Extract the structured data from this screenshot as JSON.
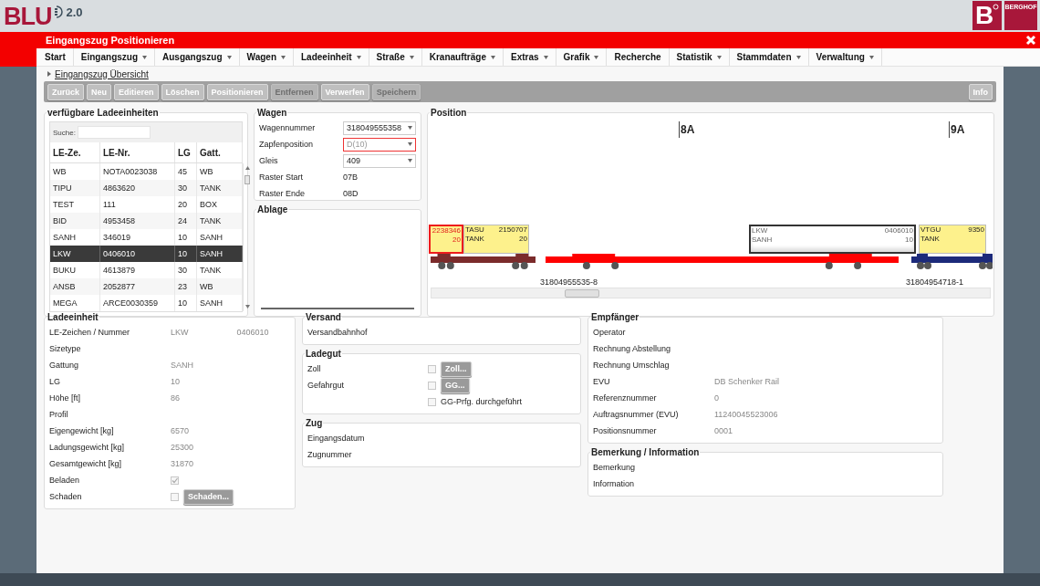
{
  "header": {
    "logo_text": "BLU",
    "version": "2.0",
    "brand_mark": "B",
    "brand_name": "BERGHOF"
  },
  "window": {
    "title": "Eingangszug Positionieren"
  },
  "menu": [
    {
      "label": "Start",
      "dropdown": false
    },
    {
      "label": "Eingangszug",
      "dropdown": true
    },
    {
      "label": "Ausgangszug",
      "dropdown": true
    },
    {
      "label": "Wagen",
      "dropdown": true
    },
    {
      "label": "Ladeeinheit",
      "dropdown": true
    },
    {
      "label": "Straße",
      "dropdown": true
    },
    {
      "label": "Kranaufträge",
      "dropdown": true
    },
    {
      "label": "Extras",
      "dropdown": true
    },
    {
      "label": "Grafik",
      "dropdown": true
    },
    {
      "label": "Recherche",
      "dropdown": false
    },
    {
      "label": "Statistik",
      "dropdown": true
    },
    {
      "label": "Stammdaten",
      "dropdown": true
    },
    {
      "label": "Verwaltung",
      "dropdown": true
    }
  ],
  "breadcrumb": "Eingangszug Übersicht",
  "toolbar": {
    "buttons": [
      {
        "label": "Zurück",
        "disabled": false
      },
      {
        "label": "Neu",
        "disabled": false
      },
      {
        "label": "Editieren",
        "disabled": false
      },
      {
        "label": "Löschen",
        "disabled": false
      },
      {
        "label": "Positionieren",
        "disabled": false
      },
      {
        "label": "Entfernen",
        "disabled": true
      },
      {
        "label": "Verwerfen",
        "disabled": false
      },
      {
        "label": "Speichern",
        "disabled": true
      }
    ],
    "info": {
      "label": "Info",
      "disabled": false
    }
  },
  "units_panel": {
    "title": "verfügbare Ladeeinheiten",
    "search_label": "Suche:",
    "columns": [
      "LE-Ze.",
      "LE-Nr.",
      "LG",
      "Gatt."
    ],
    "rows": [
      {
        "cells": [
          "WB",
          "NOTA0023038",
          "45",
          "WB"
        ],
        "selected": false
      },
      {
        "cells": [
          "TIPU",
          "4863620",
          "30",
          "TANK"
        ],
        "selected": false
      },
      {
        "cells": [
          "TEST",
          "111",
          "20",
          "BOX"
        ],
        "selected": false
      },
      {
        "cells": [
          "BID",
          "4953458",
          "24",
          "TANK"
        ],
        "selected": false
      },
      {
        "cells": [
          "SANH",
          "346019",
          "10",
          "SANH"
        ],
        "selected": false
      },
      {
        "cells": [
          "LKW",
          "0406010",
          "10",
          "SANH"
        ],
        "selected": true
      },
      {
        "cells": [
          "BUKU",
          "4613879",
          "30",
          "TANK"
        ],
        "selected": false
      },
      {
        "cells": [
          "ANSB",
          "2052877",
          "23",
          "WB"
        ],
        "selected": false
      },
      {
        "cells": [
          "MEGA",
          "ARCE0030359",
          "10",
          "SANH"
        ],
        "selected": false
      }
    ]
  },
  "wagon_panel": {
    "title": "Wagen",
    "fields": [
      {
        "label": "Wagennummer",
        "kind": "select",
        "value": "318049555358",
        "invalid": false
      },
      {
        "label": "Zapfenposition",
        "kind": "select",
        "value": "D(10)",
        "invalid": true
      },
      {
        "label": "Gleis",
        "kind": "select",
        "value": "409",
        "invalid": false
      },
      {
        "label": "Raster Start",
        "kind": "text",
        "value": "07B"
      },
      {
        "label": "Raster Ende",
        "kind": "text",
        "value": "08D"
      }
    ]
  },
  "storage_panel": {
    "title": "Ablage"
  },
  "position_panel": {
    "title": "Position",
    "grid_marks": [
      "8A",
      "9A"
    ],
    "units": [
      {
        "kind": "alert",
        "number": "2238346",
        "length": "20"
      },
      {
        "kind": "plain",
        "code": "TASU",
        "number": "2150707",
        "type": "TANK",
        "length": "20"
      },
      {
        "kind": "selected",
        "code": "LKW",
        "number": "0406010",
        "type": "SANH",
        "length": "10"
      },
      {
        "kind": "plain",
        "code": "VTGU",
        "number": "9350",
        "type": "TANK"
      }
    ],
    "wagons": [
      {
        "color": "#7b2b2b"
      },
      {
        "color": "#ff0000",
        "number": "31804955535-8"
      },
      {
        "color": "#1c2a7a",
        "number": "31804954718-1"
      }
    ]
  },
  "unit_details": {
    "title": "Ladeeinheit",
    "rows": [
      {
        "kind": "text",
        "label": "LE-Zeichen / Nummer",
        "values": [
          "LKW",
          "0406010"
        ]
      },
      {
        "kind": "text",
        "label": "Sizetype"
      },
      {
        "kind": "text",
        "label": "Gattung",
        "values": [
          "SANH"
        ]
      },
      {
        "kind": "text",
        "label": "LG",
        "values": [
          "10"
        ]
      },
      {
        "kind": "text",
        "label": "Höhe [ft]",
        "values": [
          "86"
        ]
      },
      {
        "kind": "text",
        "label": "Profil"
      },
      {
        "kind": "text",
        "label": "Eigengewicht [kg]",
        "values": [
          "6570"
        ]
      },
      {
        "kind": "text",
        "label": "Ladungsgewicht [kg]",
        "values": [
          "25300"
        ]
      },
      {
        "kind": "text",
        "label": "Gesamtgewicht [kg]",
        "values": [
          "31870"
        ]
      },
      {
        "kind": "check",
        "label": "Beladen",
        "checked": true
      },
      {
        "kind": "check",
        "label": "Schaden",
        "checked": false,
        "button": {
          "label": "Schaden...",
          "disabled": true
        }
      }
    ]
  },
  "shipping": {
    "title": "Versand",
    "rows": [
      {
        "kind": "text",
        "label": "Versandbahnhof"
      }
    ]
  },
  "cargo": {
    "title": "Ladegut",
    "rows": [
      {
        "kind": "check",
        "label": "Zoll",
        "checked": false,
        "button": {
          "label": "Zoll...",
          "disabled": true
        }
      },
      {
        "kind": "check",
        "label": "Gefahrgut",
        "checked": false,
        "button": {
          "label": "GG...",
          "disabled": true
        }
      },
      {
        "kind": "check",
        "caption": "GG-Prfg. durchgeführt",
        "checked": false
      }
    ]
  },
  "train": {
    "title": "Zug",
    "rows": [
      {
        "kind": "text",
        "label": "Eingangsdatum"
      },
      {
        "kind": "text",
        "label": "Zugnummer"
      }
    ]
  },
  "recipient": {
    "title": "Empfänger",
    "rows": [
      {
        "kind": "text",
        "label": "Operator"
      },
      {
        "kind": "text",
        "label": "Rechnung Abstellung"
      },
      {
        "kind": "text",
        "label": "Rechnung Umschlag"
      },
      {
        "kind": "text",
        "label": "EVU",
        "values": [
          "DB Schenker Rail"
        ]
      },
      {
        "kind": "text",
        "label": "Referenznummer",
        "values": [
          "0"
        ]
      },
      {
        "kind": "text",
        "label": "Auftragsnummer (EVU)",
        "values": [
          "11240045523006"
        ]
      },
      {
        "kind": "text",
        "label": "Positionsnummer",
        "values": [
          "0001"
        ]
      }
    ]
  },
  "remarks": {
    "title": "Bemerkung / Information",
    "rows": [
      {
        "kind": "text",
        "label": "Bemerkung"
      },
      {
        "kind": "text",
        "label": "Information"
      }
    ]
  }
}
